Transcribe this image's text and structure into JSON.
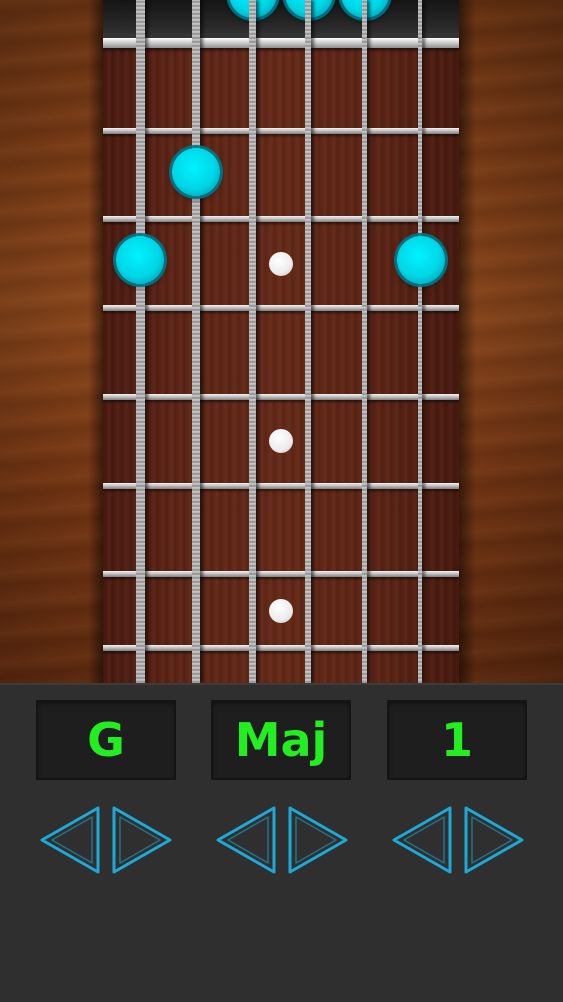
{
  "fretboard": {
    "strings": 6,
    "frets_visible": 7,
    "fingers": [
      {
        "string": 2,
        "fret": 2
      },
      {
        "string": 1,
        "fret": 3
      },
      {
        "string": 6,
        "fret": 3
      }
    ],
    "inlay_frets": [
      3,
      5,
      7
    ]
  },
  "selectors": [
    {
      "name": "root",
      "value": "G"
    },
    {
      "name": "quality",
      "value": "Maj"
    },
    {
      "name": "voicing",
      "value": "1"
    }
  ],
  "icons": {
    "prev": "triangle-left-outline-icon",
    "next": "triangle-right-outline-icon"
  },
  "colors": {
    "display_text": "#22ee22",
    "arrow_stroke": "#1ea8d6",
    "finger_marker": "#00e5f5"
  }
}
